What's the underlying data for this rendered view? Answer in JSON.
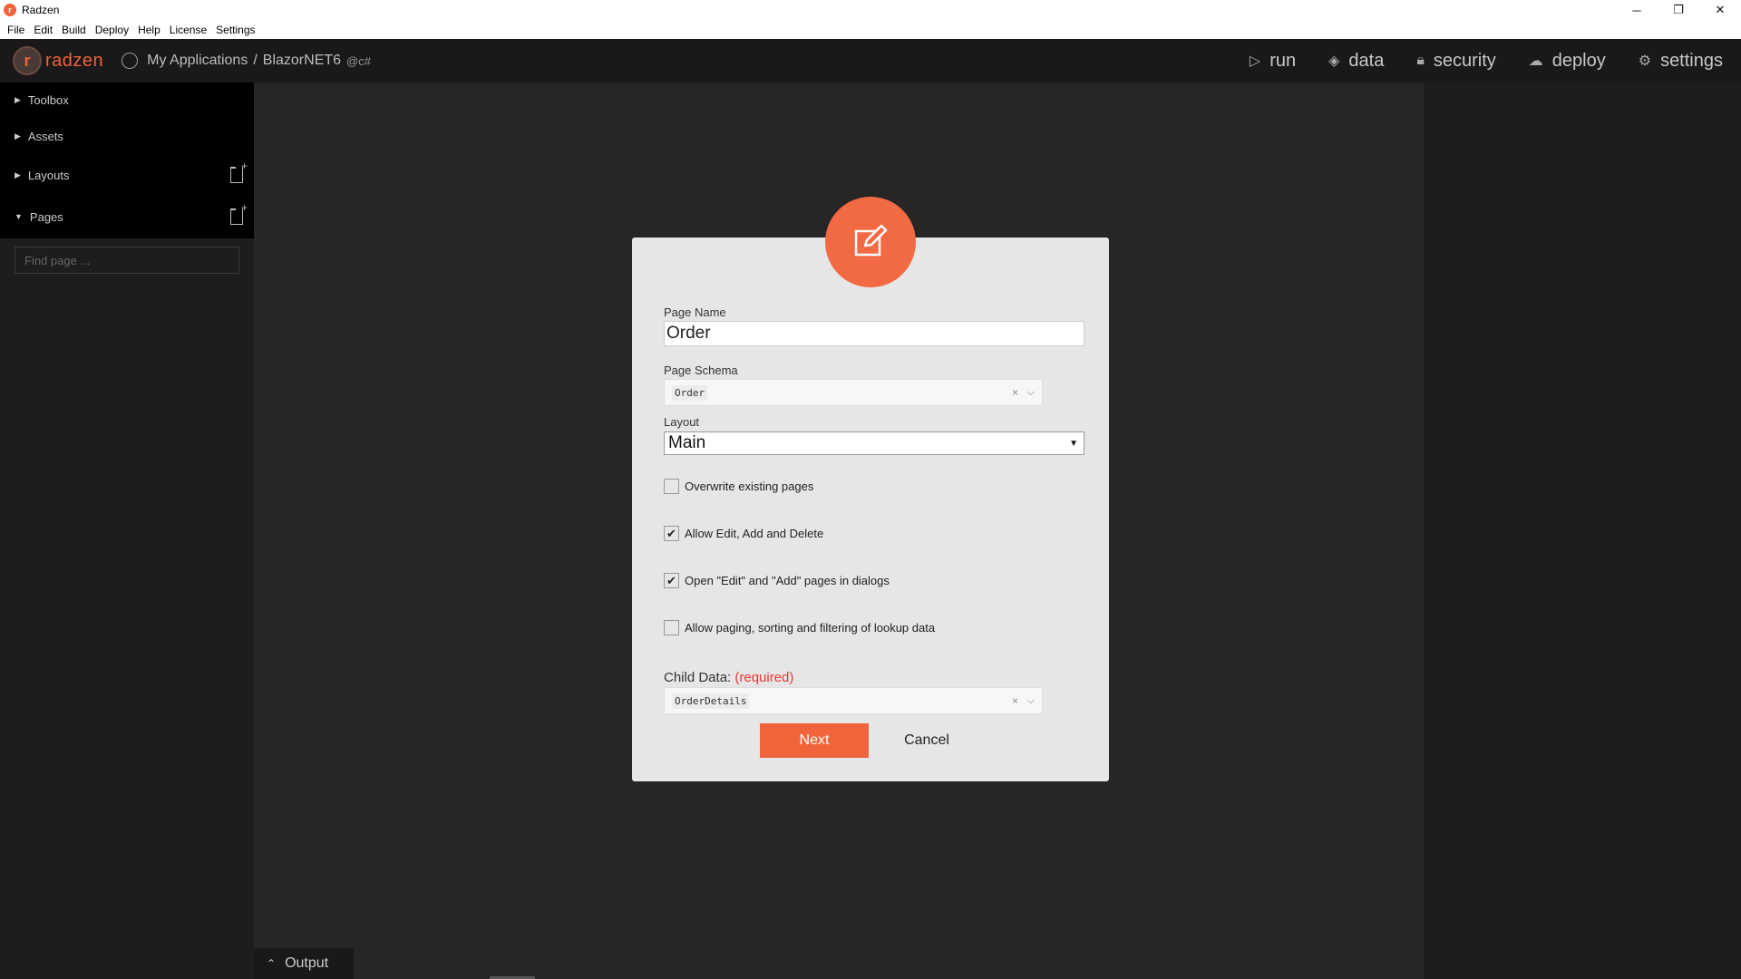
{
  "window": {
    "title": "Radzen",
    "minimize": "─",
    "restore": "❐",
    "close": "✕"
  },
  "menubar": {
    "items": [
      "File",
      "Edit",
      "Build",
      "Deploy",
      "Help",
      "License",
      "Settings"
    ]
  },
  "header": {
    "logo_text": "radzen",
    "breadcrumb_root": "My Applications",
    "breadcrumb_separator": "/",
    "breadcrumb_app": "BlazorNET6",
    "lang_badge": "@c#",
    "nav": [
      {
        "label": "run",
        "icon": "play-icon"
      },
      {
        "label": "data",
        "icon": "layers-icon"
      },
      {
        "label": "security",
        "icon": "lock-icon"
      },
      {
        "label": "deploy",
        "icon": "cloud-upload-icon"
      },
      {
        "label": "settings",
        "icon": "gear-icon"
      }
    ]
  },
  "sidebar": {
    "items": [
      {
        "label": "Toolbox",
        "expanded": false
      },
      {
        "label": "Assets",
        "expanded": false
      },
      {
        "label": "Layouts",
        "expanded": false
      },
      {
        "label": "Pages",
        "expanded": true
      }
    ],
    "find_placeholder": "Find page ..."
  },
  "output": {
    "label": "Output"
  },
  "dialog": {
    "page_name_label": "Page Name",
    "page_name_value": "Order",
    "page_schema_label": "Page Schema",
    "page_schema_value": "Order",
    "layout_label": "Layout",
    "layout_value": "Main",
    "checkboxes": [
      {
        "label": "Overwrite existing pages",
        "checked": false
      },
      {
        "label": "Allow Edit, Add and Delete",
        "checked": true
      },
      {
        "label": "Open \"Edit\" and \"Add\" pages in dialogs",
        "checked": true
      },
      {
        "label": "Allow paging, sorting and filtering of lookup data",
        "checked": false
      }
    ],
    "child_data_label": "Child Data:",
    "child_data_required": "(required)",
    "child_data_value": "OrderDetails",
    "next_label": "Next",
    "cancel_label": "Cancel"
  },
  "colors": {
    "accent": "#f0633b",
    "required": "#e53935"
  }
}
